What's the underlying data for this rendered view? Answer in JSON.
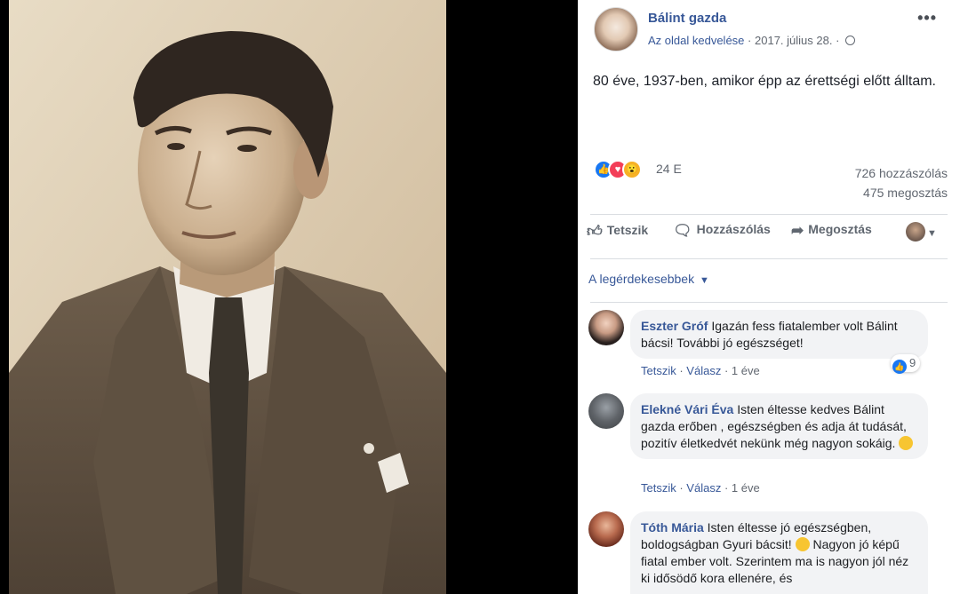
{
  "post": {
    "page_name": "Bálint gazda",
    "like_page": "Az oldal kedvelése",
    "date": "2017. július 28.",
    "separator": "·",
    "more_label": "•••",
    "text": "80 éve, 1937-ben, amikor épp az érettségi előtt álltam.",
    "reaction_count": "24 E",
    "comment_count": "726 hozzászólás",
    "share_count": "475 megosztás"
  },
  "actions": {
    "like": "Tetszik",
    "comment": "Hozzászólás",
    "share": "Megosztás"
  },
  "sort_label": "A legérdekesebbek",
  "comments": [
    {
      "author": "Eszter Gróf",
      "text": "Igazán fess fiatalember volt Bálint bácsi! További jó egészséget!",
      "like": "Tetszik",
      "reply": "Válasz",
      "time": "1 éve",
      "reaction_count": "9"
    },
    {
      "author": "Elekné Vári Éva",
      "text": "Isten éltesse kedves Bálint gazda erőben , egészségben és adja át tudását, pozitív életkedvét nekünk még nagyon sokáig.",
      "like": "Tetszik",
      "reply": "Válasz",
      "time": "1 éve"
    },
    {
      "author": "Tóth Mária",
      "text": "Isten éltesse jó egészségben, boldogságban Gyuri bácsit!",
      "text_after_emoji": "Nagyon jó képű fiatal ember volt. Szerintem ma is nagyon jól néz ki idősödő kora ellenére, és"
    }
  ],
  "icons": {
    "like": "thumbs-up-icon",
    "comment": "speech-bubble-icon",
    "share": "share-arrow-icon",
    "globe": "globe-icon"
  },
  "colors": {
    "link": "#385898",
    "like_blue": "#1877f2",
    "love_red": "#f33e58",
    "wow_yellow": "#f7b125",
    "bubble_bg": "#f2f3f5"
  }
}
